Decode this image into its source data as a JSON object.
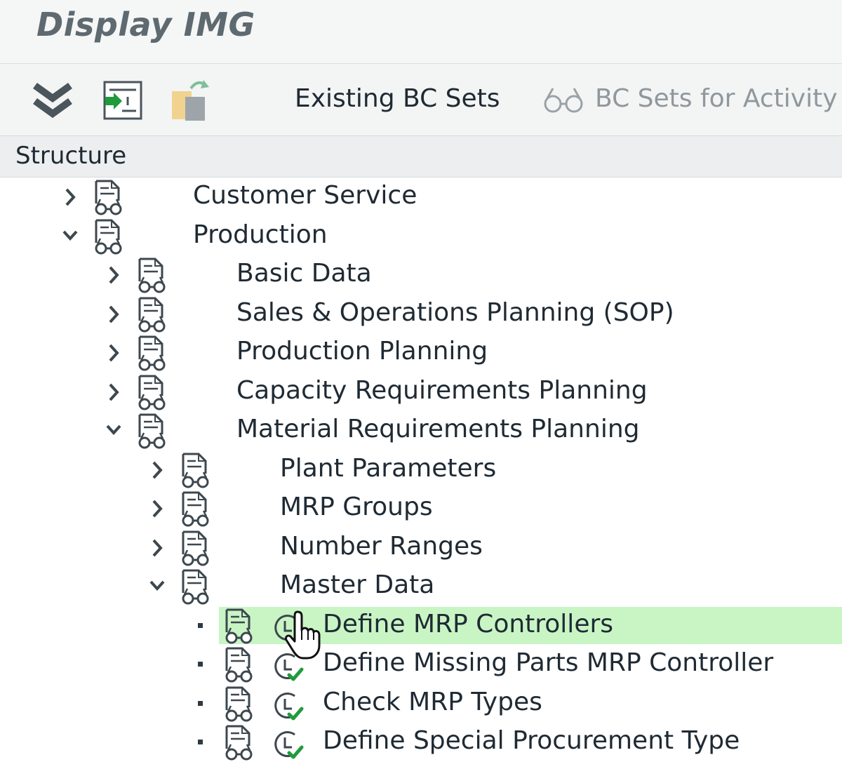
{
  "window": {
    "title": "Display IMG"
  },
  "toolbar": {
    "expand_icon": "double-chevron-down-icon",
    "execute_icon": "execute-document-icon",
    "copy_icon": "copy-transport-icon",
    "existing_bc_sets": "Existing BC Sets",
    "bc_sets_for_activity": "BC Sets for Activity",
    "bc_sets_icon": "glasses-icon"
  },
  "structure": {
    "header": "Structure",
    "selected_color": "#c9f5c5",
    "items": [
      {
        "label": "Customer Service",
        "level": 0,
        "state": "collapsed"
      },
      {
        "label": "Production",
        "level": 0,
        "state": "expanded"
      },
      {
        "label": "Basic Data",
        "level": 1,
        "state": "collapsed"
      },
      {
        "label": "Sales & Operations Planning (SOP)",
        "level": 1,
        "state": "collapsed"
      },
      {
        "label": "Production Planning",
        "level": 1,
        "state": "collapsed"
      },
      {
        "label": "Capacity Requirements Planning",
        "level": 1,
        "state": "collapsed"
      },
      {
        "label": "Material Requirements Planning",
        "level": 1,
        "state": "expanded"
      },
      {
        "label": "Plant Parameters",
        "level": 2,
        "state": "collapsed"
      },
      {
        "label": "MRP Groups",
        "level": 2,
        "state": "collapsed"
      },
      {
        "label": "Number Ranges",
        "level": 2,
        "state": "collapsed"
      },
      {
        "label": "Master Data",
        "level": 2,
        "state": "expanded"
      },
      {
        "label": "Define MRP Controllers",
        "level": 3,
        "state": "leaf",
        "selected": true
      },
      {
        "label": "Define Missing Parts MRP Controller",
        "level": 3,
        "state": "leaf"
      },
      {
        "label": "Check MRP Types",
        "level": 3,
        "state": "leaf"
      },
      {
        "label": "Define Special Procurement Type",
        "level": 3,
        "state": "leaf"
      }
    ]
  }
}
